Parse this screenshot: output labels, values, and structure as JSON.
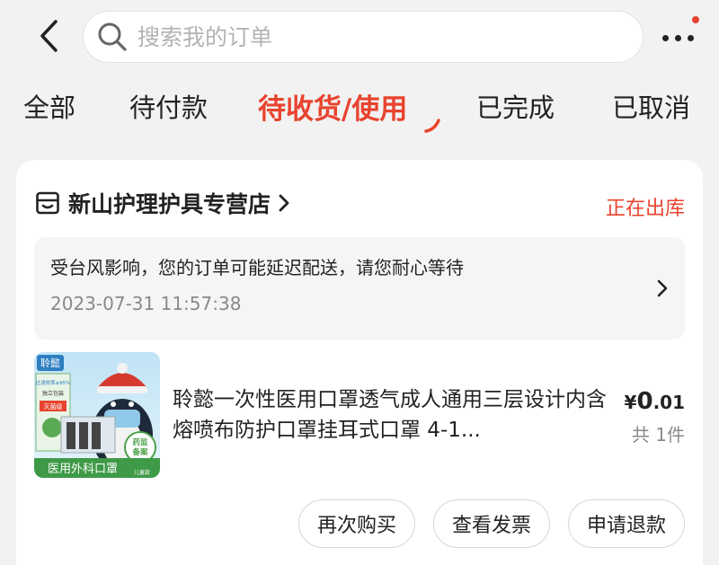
{
  "search": {
    "placeholder": "搜索我的订单",
    "value": ""
  },
  "tabs": [
    {
      "label": "全部",
      "active": false
    },
    {
      "label": "待付款",
      "active": false
    },
    {
      "label": "待收货/使用",
      "active": true
    },
    {
      "label": "已完成",
      "active": false
    },
    {
      "label": "已取消",
      "active": false
    }
  ],
  "order": {
    "store_name": "新山护理护具专营店",
    "status": "正在出库",
    "notice": {
      "text": "受台风影响，您的订单可能延迟配送，请您耐心等待",
      "time": "2023-07-31 11:57:38"
    },
    "product": {
      "title": "聆懿一次性医用口罩透气成人通用三层设计内含熔喷布防护口罩挂耳式口罩 4-1...",
      "price_symbol": "¥",
      "price_int": "0",
      "price_dec": ".01",
      "quantity": "共 1件",
      "thumb_texts": {
        "brand": "聆懿",
        "badge": "药监备案",
        "banner": "医用外科口罩",
        "small": "儿童款",
        "pack_top": "过滤效率≥95%",
        "pack_mid": "独立包装",
        "pack_tag": "灭菌级"
      }
    },
    "actions": [
      "再次购买",
      "查看发票",
      "申请退款"
    ]
  },
  "colors": {
    "accent": "#e8432e",
    "background": "#f2f2f2",
    "muted_text": "#8a8a8a"
  },
  "icons": {
    "back": "chevron-left-icon",
    "search": "search-icon",
    "more": "more-dots-icon",
    "store": "store-icon",
    "store_link": "chevron-right-icon",
    "notice_link": "chevron-right-icon"
  }
}
